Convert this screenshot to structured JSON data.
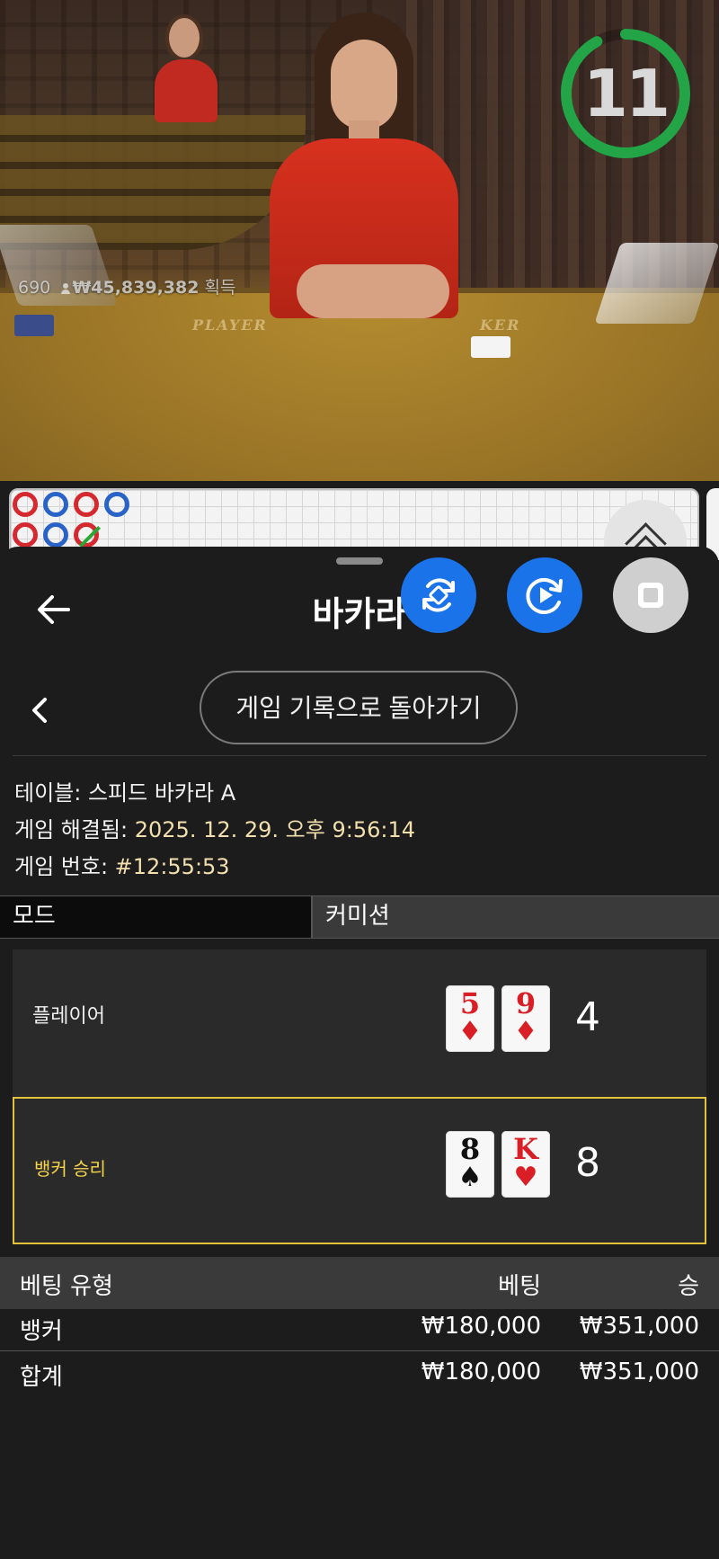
{
  "video": {
    "timer_value": "11",
    "timer_progress": 0.92,
    "players_count": "690",
    "win_amount": "₩45,839,382",
    "win_suffix": "획득",
    "felt_player": "PLAYER",
    "felt_banker": "KER"
  },
  "roadmap": {
    "beads": [
      {
        "color": "red"
      },
      {
        "color": "blue"
      },
      {
        "color": "red"
      },
      {
        "color": "blue"
      },
      {
        "color": "red"
      },
      {
        "color": "blue"
      },
      {
        "color": "red",
        "slash": true
      }
    ]
  },
  "sheet": {
    "title": "바카라",
    "history_button": "게임 기록으로 돌아가기"
  },
  "details": {
    "table_label": "테이블: ",
    "table_value": "스피드 바카라 A",
    "resolved_label": "게임 해결됨: ",
    "resolved_value": "2025. 12. 29. 오후 9:56:14",
    "game_no_label": "게임 번호: ",
    "game_no_value": "#12:55:53"
  },
  "mode": {
    "left": "모드",
    "right": "커미션"
  },
  "hands": {
    "player": {
      "label": "플레이어",
      "cards": [
        {
          "rank": "5",
          "suit": "♦",
          "color": "red"
        },
        {
          "rank": "9",
          "suit": "♦",
          "color": "red"
        }
      ],
      "score": "4"
    },
    "banker": {
      "label": "뱅커 승리",
      "cards": [
        {
          "rank": "8",
          "suit": "♠",
          "color": "black"
        },
        {
          "rank": "K",
          "suit": "♥",
          "color": "red"
        }
      ],
      "score": "8"
    }
  },
  "bets": {
    "headers": {
      "type": "베팅 유형",
      "bet": "베팅",
      "win": "승"
    },
    "rows": [
      {
        "type": "뱅커",
        "bet": "₩180,000",
        "win": "₩351,000"
      },
      {
        "type": "합계",
        "bet": "₩180,000",
        "win": "₩351,000"
      }
    ]
  },
  "colors": {
    "accent_blue": "#1a73e8",
    "timer_green": "#22a447",
    "winner_gold": "#e2c33b"
  },
  "icons": {
    "back": "arrow-left-icon",
    "prev": "chevron-left-icon",
    "rotate": "rotate-icon",
    "replay": "replay-icon",
    "stop": "stop-icon",
    "expand": "double-chevron-up-icon"
  }
}
